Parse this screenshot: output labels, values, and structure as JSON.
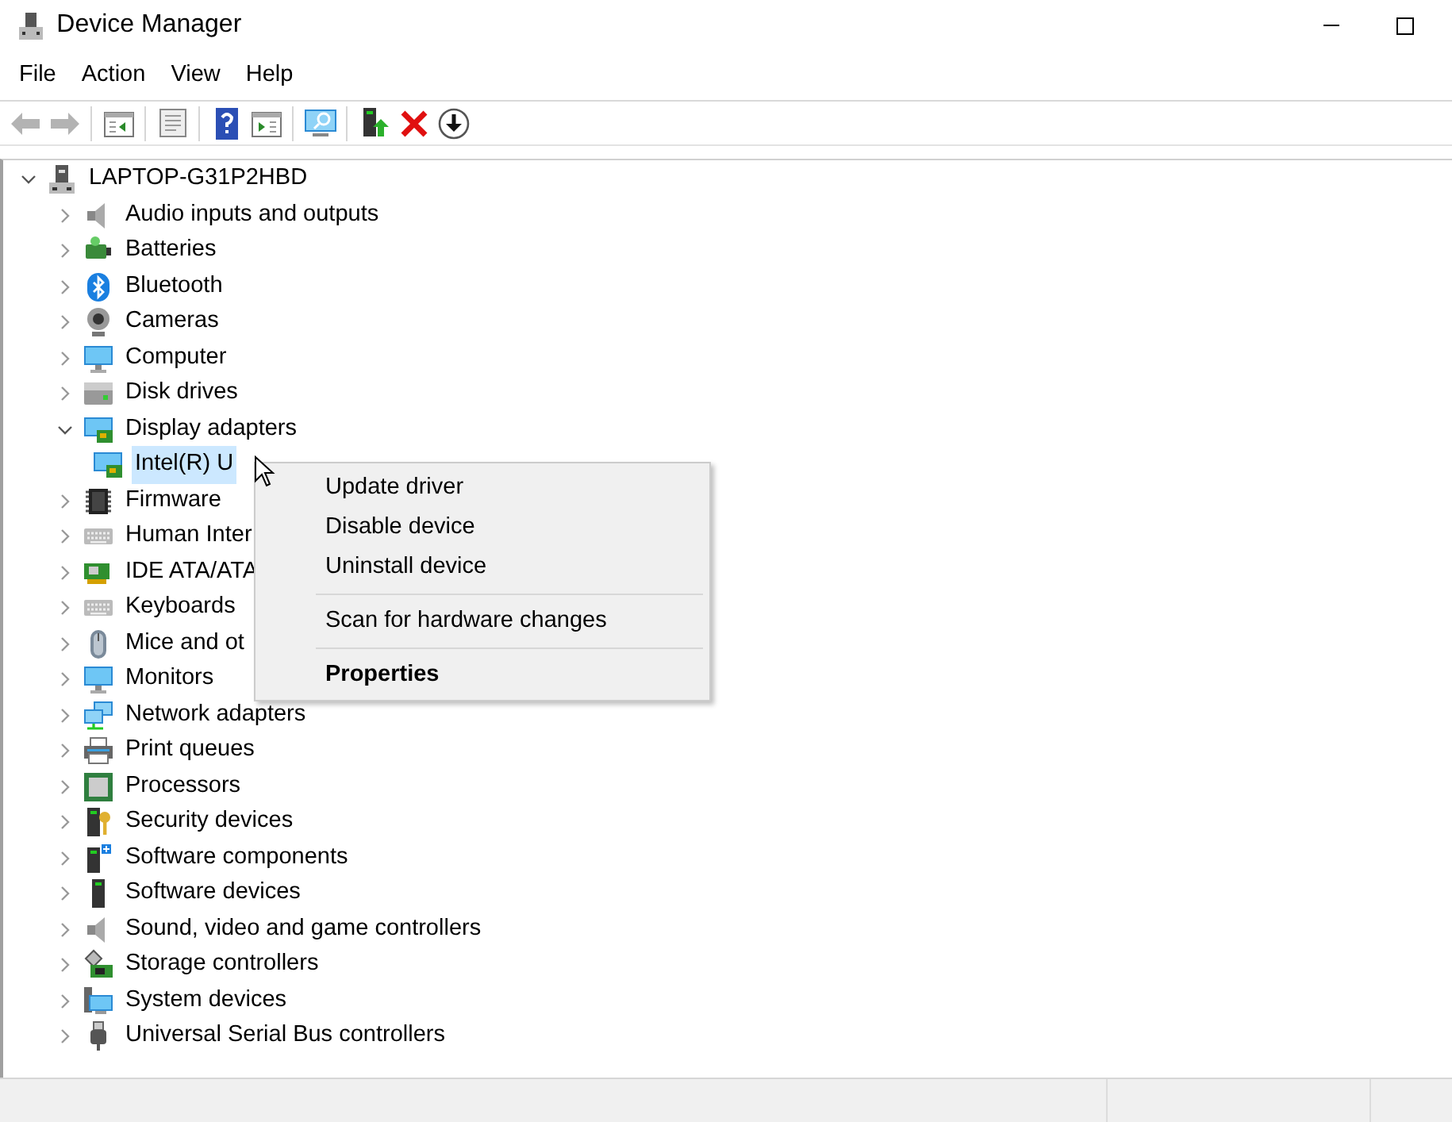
{
  "window": {
    "title": "Device Manager"
  },
  "menu_bar": [
    "File",
    "Action",
    "View",
    "Help"
  ],
  "toolbar": [
    {
      "kind": "back",
      "disabled": true
    },
    {
      "kind": "forward",
      "disabled": true
    },
    {
      "kind": "sep"
    },
    {
      "kind": "console",
      "disabled": false
    },
    {
      "kind": "sep"
    },
    {
      "kind": "properties",
      "disabled": false
    },
    {
      "kind": "sep"
    },
    {
      "kind": "help",
      "disabled": false
    },
    {
      "kind": "pane",
      "disabled": false
    },
    {
      "kind": "sep"
    },
    {
      "kind": "scan",
      "disabled": false
    },
    {
      "kind": "sep"
    },
    {
      "kind": "update",
      "disabled": false
    },
    {
      "kind": "uninstall",
      "disabled": false
    },
    {
      "kind": "disable",
      "disabled": false
    }
  ],
  "tree": {
    "label": "LAPTOP-G31P2HBD",
    "kind": "computer",
    "expanded": true,
    "selected": false,
    "children": [
      {
        "label": "Audio inputs and outputs",
        "kind": "speaker",
        "expanded": false,
        "selected": false
      },
      {
        "label": "Batteries",
        "kind": "battery",
        "expanded": false,
        "selected": false
      },
      {
        "label": "Bluetooth",
        "kind": "bluetooth",
        "expanded": false,
        "selected": false
      },
      {
        "label": "Cameras",
        "kind": "camera",
        "expanded": false,
        "selected": false
      },
      {
        "label": "Computer",
        "kind": "monitor",
        "expanded": false,
        "selected": false
      },
      {
        "label": "Disk drives",
        "kind": "disk",
        "expanded": false,
        "selected": false
      },
      {
        "label": "Display adapters",
        "kind": "display",
        "expanded": true,
        "selected": false,
        "children": [
          {
            "label": "Intel(R) U",
            "kind": "display",
            "selected": true
          }
        ]
      },
      {
        "label": "Firmware",
        "kind": "chip",
        "expanded": false,
        "selected": false
      },
      {
        "label": "Human Inter",
        "kind": "keyboard",
        "expanded": false,
        "selected": false
      },
      {
        "label": "IDE ATA/ATA",
        "kind": "card",
        "expanded": false,
        "selected": false
      },
      {
        "label": "Keyboards",
        "kind": "keyboard",
        "expanded": false,
        "selected": false
      },
      {
        "label": "Mice and ot",
        "kind": "mouse",
        "expanded": false,
        "selected": false
      },
      {
        "label": "Monitors",
        "kind": "monitor",
        "expanded": false,
        "selected": false
      },
      {
        "label": "Network adapters",
        "kind": "network",
        "expanded": false,
        "selected": false
      },
      {
        "label": "Print queues",
        "kind": "printer",
        "expanded": false,
        "selected": false
      },
      {
        "label": "Processors",
        "kind": "processor",
        "expanded": false,
        "selected": false
      },
      {
        "label": "Security devices",
        "kind": "security",
        "expanded": false,
        "selected": false
      },
      {
        "label": "Software components",
        "kind": "component",
        "expanded": false,
        "selected": false
      },
      {
        "label": "Software devices",
        "kind": "tower",
        "expanded": false,
        "selected": false
      },
      {
        "label": "Sound, video and game controllers",
        "kind": "speaker",
        "expanded": false,
        "selected": false
      },
      {
        "label": "Storage controllers",
        "kind": "storage",
        "expanded": false,
        "selected": false
      },
      {
        "label": "System devices",
        "kind": "system",
        "expanded": false,
        "selected": false
      },
      {
        "label": "Universal Serial Bus controllers",
        "kind": "usb",
        "expanded": false,
        "selected": false
      }
    ]
  },
  "context_menu": [
    {
      "kind": "item",
      "label": "Update driver",
      "default": false
    },
    {
      "kind": "item",
      "label": "Disable device",
      "default": false
    },
    {
      "kind": "item",
      "label": "Uninstall device",
      "default": false
    },
    {
      "kind": "separator"
    },
    {
      "kind": "item",
      "label": "Scan for hardware changes",
      "default": false
    },
    {
      "kind": "separator"
    },
    {
      "kind": "item",
      "label": "Properties",
      "default": true
    }
  ]
}
